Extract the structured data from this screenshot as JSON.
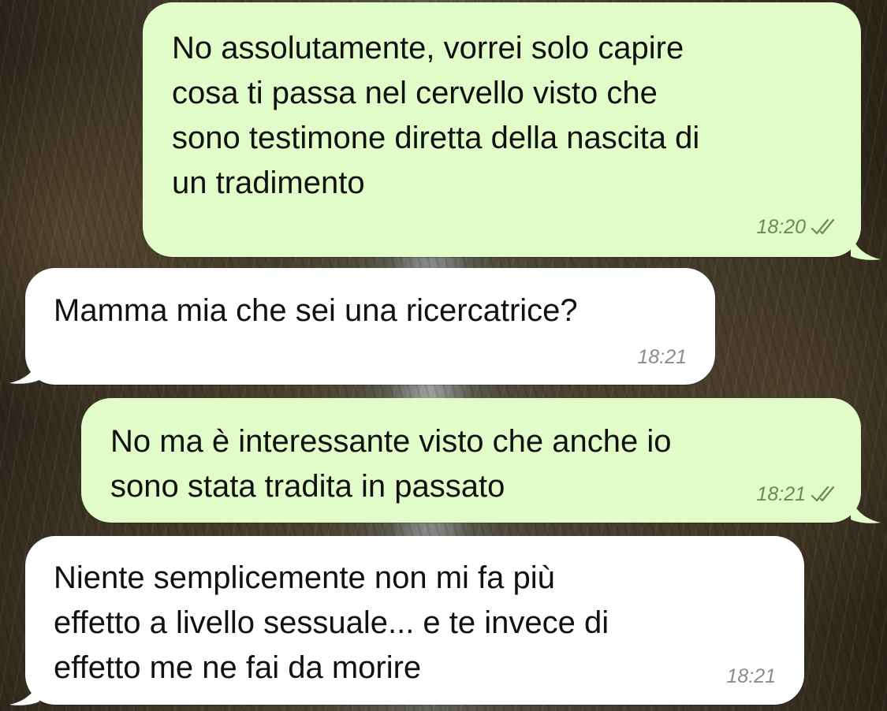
{
  "colors": {
    "outgoing_bubble": "#e2fcc9",
    "incoming_bubble": "#ffffff",
    "outgoing_meta": "#6a8a55",
    "incoming_meta": "#8c8c8c"
  },
  "messages": [
    {
      "direction": "outgoing",
      "text": "No assolutamente, vorrei solo capire\ncosa ti passa nel cervello visto che\nsono testimone diretta della nascita di\nun tradimento",
      "time": "18:20",
      "status_icon": "double-check-icon"
    },
    {
      "direction": "incoming",
      "text": "Mamma mia che sei una ricercatrice?",
      "time": "18:21"
    },
    {
      "direction": "outgoing",
      "text": "No ma è interessante visto che anche io\nsono stata tradita in passato",
      "time": "18:21",
      "status_icon": "double-check-icon"
    },
    {
      "direction": "incoming",
      "text": "Niente semplicemente non mi fa più\neffetto a livello sessuale... e te invece di\neffetto me ne fai da morire",
      "time": "18:21"
    }
  ]
}
